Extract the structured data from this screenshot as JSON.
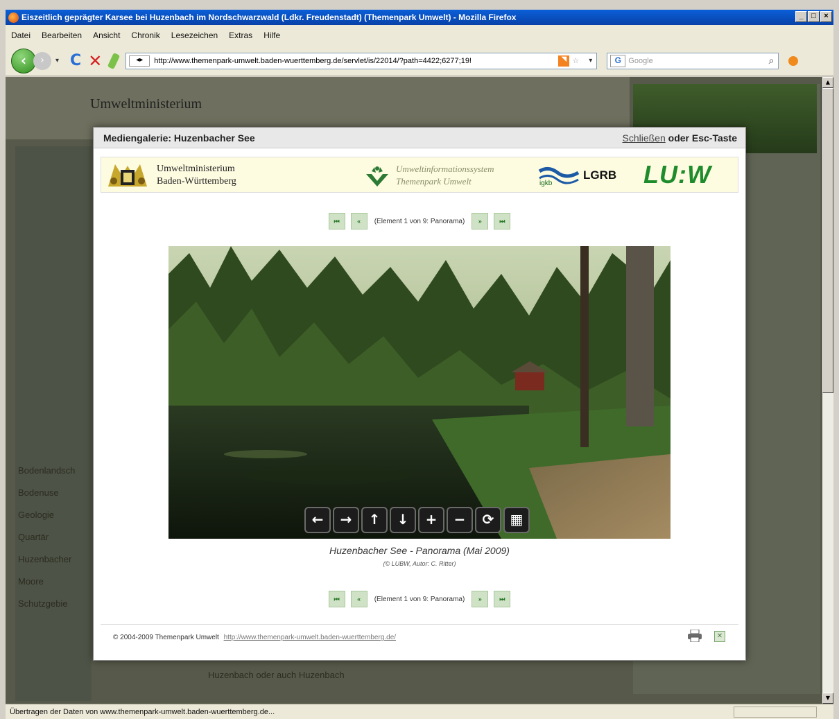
{
  "window": {
    "title": "Eiszeitlich geprägter Karsee bei Huzenbach im Nordschwarzwald (Ldkr. Freudenstadt) (Themenpark Umwelt) - Mozilla Firefox",
    "controls": [
      "_",
      "□",
      "×"
    ]
  },
  "menu": [
    "Datei",
    "Bearbeiten",
    "Ansicht",
    "Chronik",
    "Lesezeichen",
    "Extras",
    "Hilfe"
  ],
  "toolbar": {
    "url": "http://www.themenpark-umwelt.baden-wuerttemberg.de/servlet/is/22014/?path=4422;6277;19!",
    "search_placeholder": "Google"
  },
  "background_page": {
    "header_text": "Umweltministerium",
    "left_items": [
      "Bodenlandsch",
      "Bodenuse",
      "Geologie",
      "Quartär",
      "Huzenbacher",
      "Moore",
      "Schutzgebie"
    ],
    "bottom_text": "Huzenbach oder auch Huzenbach"
  },
  "modal": {
    "title": "Mediengalerie: Huzenbacher See",
    "close_link": "Schließen",
    "close_suffix": " oder Esc-Taste",
    "ministry_line1": "Umweltministerium",
    "ministry_line2": "Baden-Württemberg",
    "uis_line1": "Umweltinformationssystem",
    "uis_line2": "Themenpark Umwelt",
    "igkb": "igkb",
    "lgrb": "LGRB",
    "lubw": "LU:W",
    "pager_text": "(Element 1 von 9: Panorama)",
    "pager_buttons": [
      "⏮",
      "«",
      "»",
      "⏭"
    ],
    "caption": "Huzenbacher See - Panorama (Mai 2009)",
    "credit": "(© LUBW, Autor: C. Ritter)",
    "footer_text": "© 2004-2009 Themenpark Umwelt",
    "footer_link": "http://www.themenpark-umwelt.baden-wuerttemberg.de/",
    "tools": [
      "←",
      "→",
      "↑",
      "↓",
      "+",
      "−",
      "⟳",
      "▦"
    ]
  },
  "status": {
    "text": "Übertragen der Daten von www.themenpark-umwelt.baden-wuerttemberg.de..."
  },
  "colors": {
    "accent_green": "#1e8c2c",
    "pager_bg": "#cfe2c6",
    "dim_bg": "#575a4a"
  }
}
